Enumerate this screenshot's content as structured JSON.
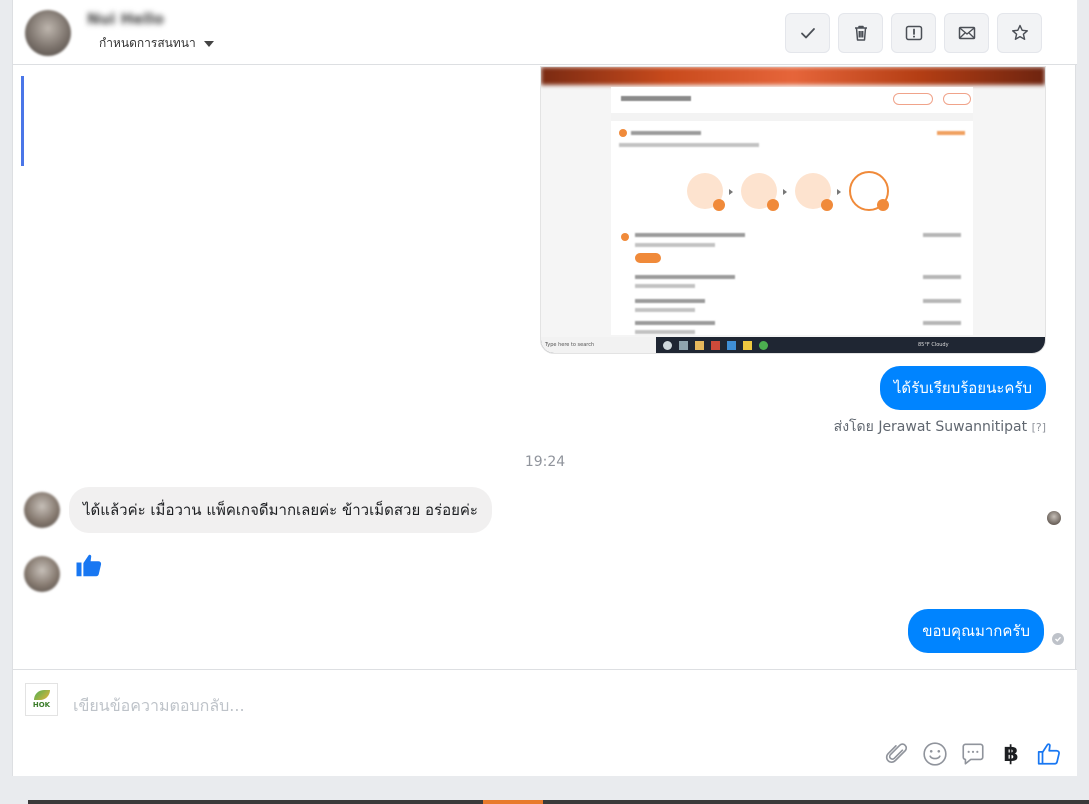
{
  "header": {
    "contact_name": "Nui Hello",
    "dropdown_label": "กำหนดการสนทนา",
    "actions": [
      {
        "name": "mark-done",
        "icon": "checkmark-icon"
      },
      {
        "name": "delete",
        "icon": "trash-icon"
      },
      {
        "name": "report-spam",
        "icon": "alert-icon"
      },
      {
        "name": "mark-unread",
        "icon": "envelope-icon"
      },
      {
        "name": "star",
        "icon": "star-icon"
      }
    ]
  },
  "screenshot_attachment": {
    "taskbar_search": "Type here to search",
    "weather": "85°F Cloudy"
  },
  "messages": {
    "outgoing_1": "ได้รับเรียบร้อยนะครับ",
    "sent_by_prefix": "ส่งโดย",
    "sent_by_name": "Jerawat Suwannitipat",
    "sent_by_help": "[?]",
    "timestamp": "19:24",
    "incoming_1": "ได้แล้วค่ะ เมื่อวาน  แพ็คเกจดีมากเลยค่ะ ข้าวเม็ดสวย อร่อยค่ะ",
    "incoming_2_icon": "thumbs-up-icon",
    "outgoing_2": "ขอบคุณมากครับ"
  },
  "composer": {
    "logo_text": "HOK",
    "placeholder": "เขียนข้อความตอบกลับ...",
    "tools": [
      "paperclip-icon",
      "emoji-icon",
      "saved-reply-icon",
      "baht-icon",
      "thumbs-up-icon"
    ],
    "baht_symbol": "฿"
  },
  "colors": {
    "accent": "#0084ff",
    "incoming_bubble": "#f1f0f0",
    "like_blue": "#1877f2"
  }
}
